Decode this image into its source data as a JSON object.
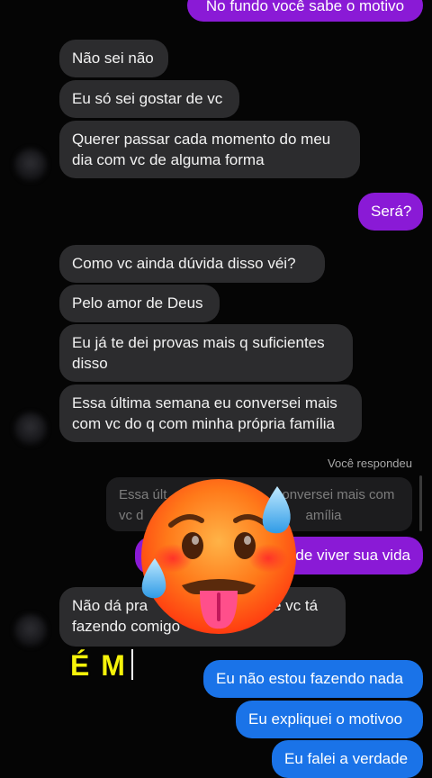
{
  "messages_top": {
    "sent_partial": "No fundo você sabe o motivo"
  },
  "group1": [
    "Não sei não",
    "Eu só sei gostar de vc",
    "Querer passar cada momento do meu dia com vc de alguma forma"
  ],
  "sent_sera": "Será?",
  "group2": [
    "Como vc ainda dúvida disso véi?",
    "Pelo amor de Deus",
    "Eu já te dei provas mais q suficientes disso",
    "Essa última semana eu conversei mais com vc do q com minha própria família"
  ],
  "reply": {
    "label": "Você respondeu",
    "quoted_line1": "Essa últ",
    "quoted_line1b": "onversei mais com",
    "quoted_line2": "vc d",
    "quoted_line2b": "amília",
    "reply_text": "de viver sua vida"
  },
  "incoming_last": {
    "line1a": "Não dá pra",
    "line1b": "que vc tá",
    "line2": "fazendo comigo"
  },
  "overlay": {
    "text": "É M"
  },
  "sent_bottom": [
    "Eu não estou fazendo nada",
    "Eu expliquei o motivoo",
    "Eu falei a verdade"
  ],
  "emoji": {
    "icon": "hot-face-emoji"
  },
  "colors": {
    "incoming": "#2c2c2e",
    "purple": "#8a1ad6",
    "blue": "#1a73e8",
    "overlay": "#f5f20a"
  }
}
